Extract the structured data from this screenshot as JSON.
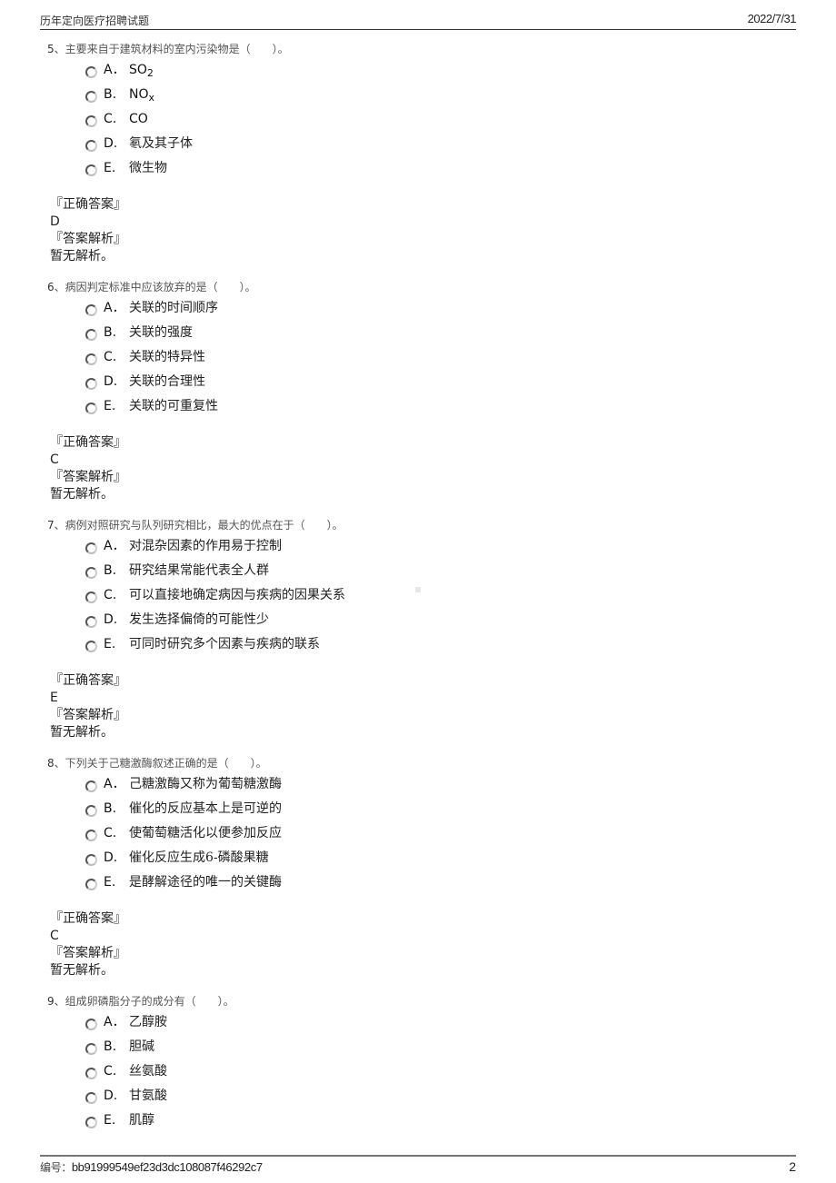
{
  "header": {
    "title": "历年定向医疗招聘试题",
    "date": "2022/7/31"
  },
  "questions": [
    {
      "number": "5",
      "text": "、主要来自于建筑材料的室内污染物是（　　）。",
      "options": [
        {
          "letter": "A．",
          "text": "SO",
          "sub": "2"
        },
        {
          "letter": "B.",
          "text": "NO",
          "sub": "x"
        },
        {
          "letter": "C.",
          "text": "CO"
        },
        {
          "letter": "D.",
          "text": "氡及其子体"
        },
        {
          "letter": "E.",
          "text": "微生物"
        }
      ],
      "answer_label": "『正确答案』",
      "answer": "D",
      "explanation_label": "『答案解析』",
      "explanation": "暂无解析。"
    },
    {
      "number": "6",
      "text": "、病因判定标准中应该放弃的是（　　）。",
      "options": [
        {
          "letter": "A．",
          "text": "关联的时间顺序"
        },
        {
          "letter": "B.",
          "text": "关联的强度"
        },
        {
          "letter": "C.",
          "text": "关联的特异性"
        },
        {
          "letter": "D.",
          "text": "关联的合理性"
        },
        {
          "letter": "E.",
          "text": "关联的可重复性"
        }
      ],
      "answer_label": "『正确答案』",
      "answer": "C",
      "explanation_label": "『答案解析』",
      "explanation": "暂无解析。"
    },
    {
      "number": "7",
      "text": "、病例对照研究与队列研究相比，最大的优点在于（　　）。",
      "options": [
        {
          "letter": "A．",
          "text": "对混杂因素的作用易于控制"
        },
        {
          "letter": "B.",
          "text": "研究结果常能代表全人群"
        },
        {
          "letter": "C.",
          "text": "可以直接地确定病因与疾病的因果关系"
        },
        {
          "letter": "D.",
          "text": "发生选择偏倚的可能性少"
        },
        {
          "letter": "E.",
          "text": "可同时研究多个因素与疾病的联系"
        }
      ],
      "answer_label": "『正确答案』",
      "answer": "E",
      "explanation_label": "『答案解析』",
      "explanation": "暂无解析。"
    },
    {
      "number": "8",
      "text": "、下列关于己糖激酶叙述正确的是（　　）。",
      "options": [
        {
          "letter": "A．",
          "text": "己糖激酶又称为葡萄糖激酶"
        },
        {
          "letter": "B.",
          "text": "催化的反应基本上是可逆的"
        },
        {
          "letter": "C.",
          "text": "使葡萄糖活化以便参加反应"
        },
        {
          "letter": "D.",
          "text": "催化反应生成6-磷酸果糖"
        },
        {
          "letter": "E.",
          "text": "是酵解途径的唯一的关键酶"
        }
      ],
      "answer_label": "『正确答案』",
      "answer": "C",
      "explanation_label": "『答案解析』",
      "explanation": "暂无解析。"
    },
    {
      "number": "9",
      "text": "、组成卵磷脂分子的成分有（　　）。",
      "options": [
        {
          "letter": "A．",
          "text": "乙醇胺"
        },
        {
          "letter": "B.",
          "text": "胆碱"
        },
        {
          "letter": "C.",
          "text": "丝氨酸"
        },
        {
          "letter": "D.",
          "text": "甘氨酸"
        },
        {
          "letter": "E.",
          "text": "肌醇"
        }
      ]
    }
  ],
  "footer": {
    "code_label": "编号：",
    "code": "bb91999549ef23d3dc108087f46292c7",
    "page": "2"
  }
}
